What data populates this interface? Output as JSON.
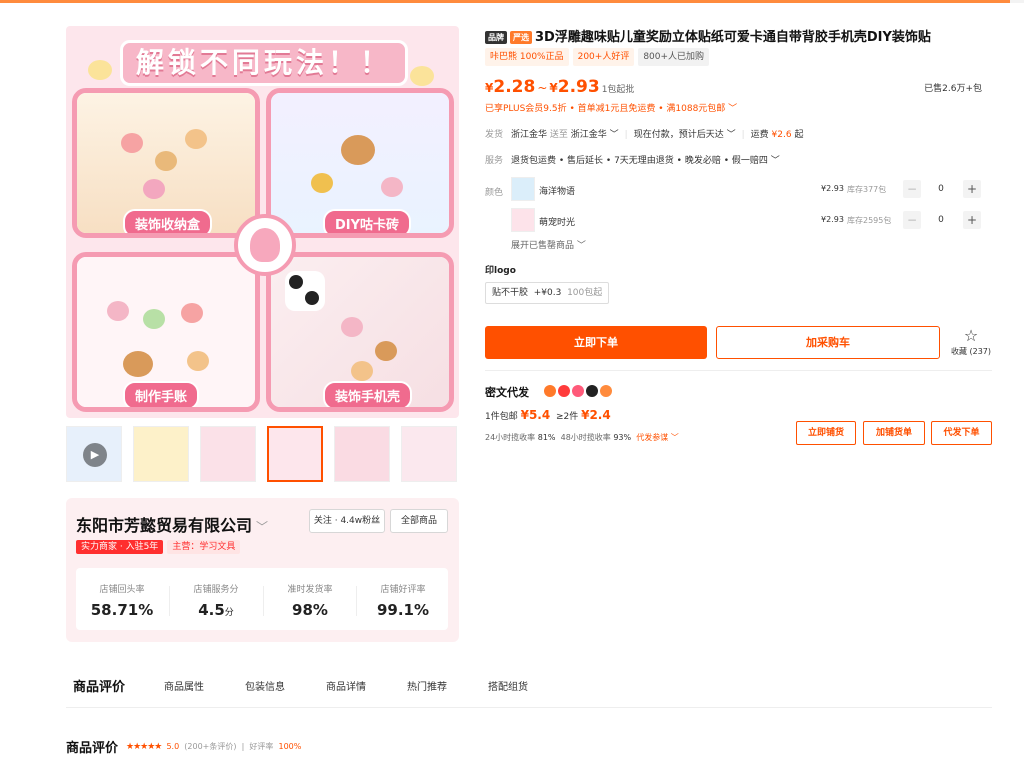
{
  "gallery": {
    "banner": "解锁不同玩法！！",
    "panels": [
      "装饰收纳盒",
      "DIY咕卡砖",
      "制作手账",
      "装饰手机壳"
    ],
    "play_icon": "play-icon"
  },
  "store": {
    "name": "东阳市芳懿贸易有限公司",
    "follow": "关注 · 4.4w粉丝",
    "all_products": "全部商品",
    "tag_power": "实力商家 · 入驻5年",
    "tag_main": "主营：学习文具",
    "stats": [
      {
        "label": "店铺回头率",
        "value": "58.71%",
        "unit": ""
      },
      {
        "label": "店铺服务分",
        "value": "4.5",
        "unit": "分"
      },
      {
        "label": "准时发货率",
        "value": "98%",
        "unit": ""
      },
      {
        "label": "店铺好评率",
        "value": "99.1%",
        "unit": ""
      }
    ]
  },
  "product": {
    "badge_brand": "品牌",
    "badge_select": "严选",
    "title": "3D浮雕趣味贴儿童奖励立体贴纸可爱卡通自带背胶手机壳DIY装饰贴",
    "chips": [
      "咔巴熊 100%正品",
      "200+人好评",
      "800+人已加购"
    ],
    "price_currency": "¥",
    "price_low": "2.28",
    "price_sep": "~",
    "price_high": "2.93",
    "price_unit": "1包起批",
    "sold": "已售2.6万+包",
    "promo": "已享PLUS会员9.5折 • 首单减1元且免运费 • 满1088元包邮 ﹀"
  },
  "shipping": {
    "label": "发货",
    "from": "浙江金华",
    "to_word": "送至",
    "to": "浙江金华 ﹀",
    "timing": "现在付款，预计后天达 ﹀",
    "fee_label": "运费",
    "fee": "¥2.6",
    "fee_suffix": "起"
  },
  "service": {
    "label": "服务",
    "text": "退货包运费 • 售后延长 • 7天无理由退货 • 晚发必赔 • 假一赔四 ﹀"
  },
  "sku": {
    "label": "颜色",
    "items": [
      {
        "name": "海洋物语",
        "price": "¥2.93",
        "stock": "库存377包",
        "qty": "0"
      },
      {
        "name": "萌宠时光",
        "price": "¥2.93",
        "stock": "库存2595包",
        "qty": "0"
      }
    ],
    "minus": "−",
    "plus": "+",
    "expand": "展开已售罄商品 ﹀"
  },
  "logo": {
    "label": "印logo",
    "option": "贴不干胶",
    "add_price": "+¥0.3",
    "min": "100包起"
  },
  "actions": {
    "order": "立即下单",
    "cart": "加采购车",
    "fav_icon": "star-icon",
    "fav": "收藏 (237)"
  },
  "dropship": {
    "title": "密文代发",
    "ship_1": "1件包邮",
    "price_1": "¥5.4",
    "ship_2": "≥2件",
    "price_2": "¥2.4",
    "rate_24_label": "24小时揽收率",
    "rate_24": "81%",
    "rate_48_label": "48小时揽收率",
    "rate_48": "93%",
    "rule": "代发参谋 ﹀",
    "btn_shop": "立即铺货",
    "btn_add": "加铺货单",
    "btn_send": "代发下单"
  },
  "tabs": [
    "商品评价",
    "商品属性",
    "包装信息",
    "商品详情",
    "热门推荐",
    "搭配组货"
  ],
  "review": {
    "heading": "商品评价",
    "stars": "★★★★★",
    "score": "5.0",
    "count": "(200+条评价)",
    "divider": "|",
    "good_rate_label": "好评率",
    "good_rate": "100%"
  },
  "colors": {
    "accent": "#ff5000",
    "pink": "#f59bb2"
  }
}
